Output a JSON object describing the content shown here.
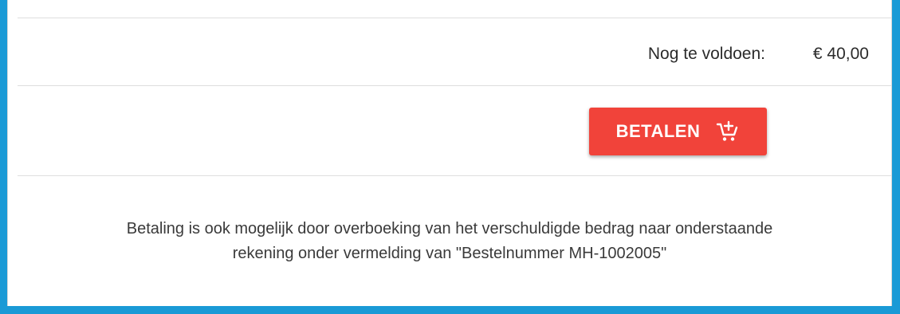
{
  "summary": {
    "outstanding_label": "Nog te voldoen:",
    "outstanding_amount": "€ 40,00"
  },
  "actions": {
    "pay_label": "BETALEN",
    "pay_icon": "cart-add-icon",
    "pay_color": "#f1433a"
  },
  "notice": {
    "line1": "Betaling is ook mogelijk door overboeking van het verschuldigde bedrag naar onderstaande",
    "line2": "rekening onder vermelding van \"Bestelnummer MH-1002005\""
  },
  "theme": {
    "frame_color": "#1a9ad6"
  }
}
